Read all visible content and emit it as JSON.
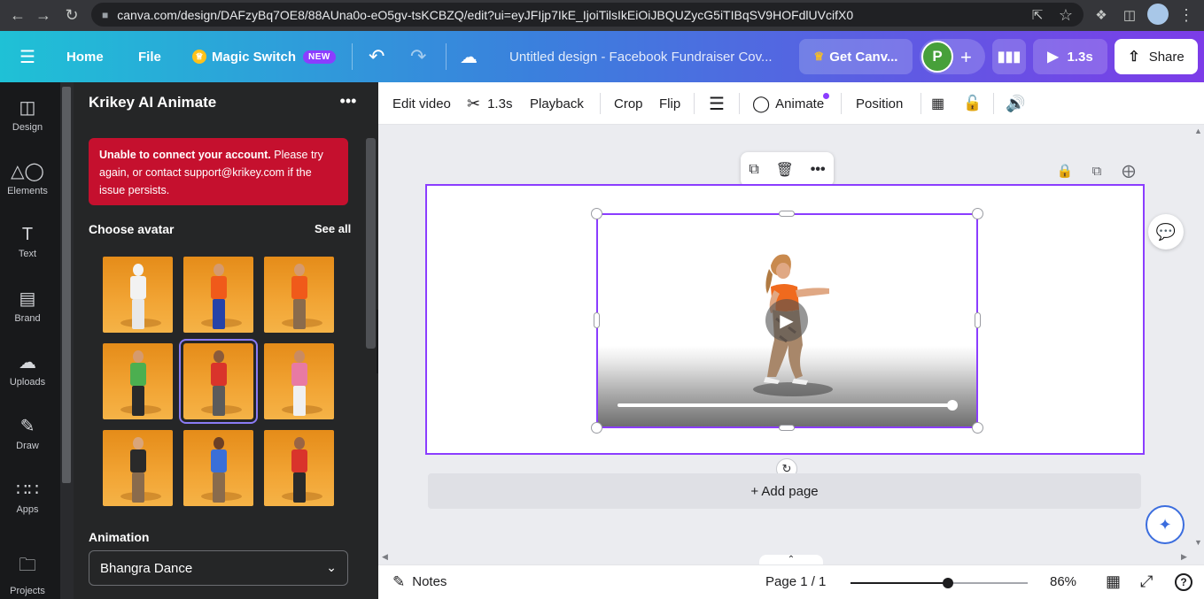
{
  "browser": {
    "url": "canva.com/design/DAFzyBq7OE8/88AUna0o-eO5gv-tsKCBZQ/edit?ui=eyJFIjp7IkE_IjoiTilsIkEiOiJBQUZycG5iTIBqSV9HOFdlUVcifX0"
  },
  "topbar": {
    "home": "Home",
    "file": "File",
    "magic_switch": "Magic Switch",
    "new_badge": "NEW",
    "doc_title": "Untitled design - Facebook Fundraiser Cov...",
    "get_canva": "Get Canv...",
    "avatar_letter": "P",
    "play_duration": "1.3s",
    "share": "Share"
  },
  "rail": {
    "items": [
      {
        "label": "Design",
        "icon": "design-icon"
      },
      {
        "label": "Elements",
        "icon": "elements-icon"
      },
      {
        "label": "Text",
        "icon": "text-icon"
      },
      {
        "label": "Brand",
        "icon": "brand-icon"
      },
      {
        "label": "Uploads",
        "icon": "uploads-icon"
      },
      {
        "label": "Draw",
        "icon": "draw-icon"
      },
      {
        "label": "Apps",
        "icon": "apps-icon"
      },
      {
        "label": "Projects",
        "icon": "projects-icon"
      }
    ]
  },
  "panel": {
    "title": "Krikey AI Animate",
    "error_bold": "Unable to connect your account.",
    "error_rest": " Please try again, or contact support@krikey.com if the issue persists.",
    "choose_avatar": "Choose avatar",
    "see_all": "See all",
    "animation_label": "Animation",
    "animation_value": "Bhangra Dance",
    "avatars": [
      {
        "shirt": "#f2f2f2",
        "pants": "#e8e8e8",
        "skin": "#f3f3f3",
        "selected": false
      },
      {
        "shirt": "#f05a1a",
        "pants": "#2643a8",
        "skin": "#d59a6e",
        "selected": false
      },
      {
        "shirt": "#f05a1a",
        "pants": "#8a6b4c",
        "skin": "#d59a6e",
        "selected": false
      },
      {
        "shirt": "#4caf50",
        "pants": "#2a2a2a",
        "skin": "#d59a6e",
        "selected": false
      },
      {
        "shirt": "#d9342b",
        "pants": "#5b5b5b",
        "skin": "#8a5a3b",
        "selected": true
      },
      {
        "shirt": "#e87aa3",
        "pants": "#f0f0f0",
        "skin": "#c98b63",
        "selected": false
      },
      {
        "shirt": "#2a2a2a",
        "pants": "#8a6b4c",
        "skin": "#d9a57a",
        "selected": false
      },
      {
        "shirt": "#3a6fd8",
        "pants": "#8a6b4c",
        "skin": "#6b3f25",
        "selected": false
      },
      {
        "shirt": "#d9342b",
        "pants": "#2a2a2a",
        "skin": "#9a6444",
        "selected": false
      }
    ]
  },
  "editbar": {
    "edit_video": "Edit video",
    "duration": "1.3s",
    "playback": "Playback",
    "crop": "Crop",
    "flip": "Flip",
    "animate": "Animate",
    "position": "Position"
  },
  "canvas": {
    "add_page": "+ Add page",
    "video_progress": 1.0
  },
  "bottombar": {
    "notes": "Notes",
    "page_indicator": "Page 1 / 1",
    "zoom": "86%",
    "zoom_fraction": 0.55
  },
  "colors": {
    "accent": "#8b3dff",
    "error": "#c5102e"
  }
}
